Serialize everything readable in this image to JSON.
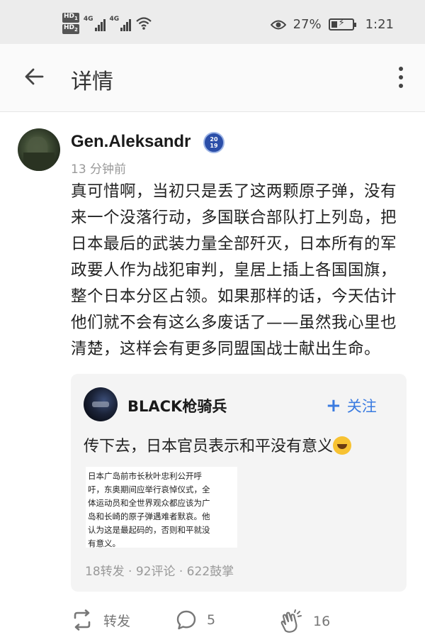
{
  "status_bar": {
    "network_1": "4G",
    "network_2": "4G",
    "battery_percent": "27%",
    "time": "1:21"
  },
  "header": {
    "title": "详情"
  },
  "post": {
    "username": "Gen.Aleksandr",
    "badge_line1": "20",
    "badge_line2": "19",
    "time_ago": "13 分钟前",
    "content_lines": [
      "真可惜啊，当初只是丢了这两颗原子弹，没有",
      "来一个没落行动，多国联合部队打上列岛，把",
      "日本最后的武装力量全部歼灭，日本所有的军",
      "政要人作为战犯审判，皇居上插上各国国旗，",
      "整个日本分区占领。如果那样的话，今天估计",
      "他们就不会有这么多废话了——虽然我心里也",
      "清楚，这样会有更多同盟国战士献出生命。"
    ]
  },
  "quote": {
    "username": "BLACK枪骑兵",
    "follow_label": "关注",
    "text": "传下去，日本官员表示和平没有意义",
    "image_text_lines": [
      "日本广岛前市长秋叶忠利公开呼",
      "吁，东奥期间应举行哀悼仪式，全",
      "体运动员和全世界观众都应该为广",
      "岛和长崎的原子弹遇难者默哀。他",
      "认为这是最起码的，否则和平就没",
      "有意义。"
    ],
    "stats": "18转发 · 92评论 · 622鼓掌"
  },
  "actions": {
    "repost_label": "转发",
    "comment_count": "5",
    "clap_count": "16"
  },
  "colors": {
    "accent": "#3a7be0",
    "muted": "#999999",
    "status_bar_bg": "#ececec"
  },
  "icons": {
    "back": "arrow-left-icon",
    "more": "more-vertical-icon",
    "repost": "repost-icon",
    "comment": "comment-bubble-icon",
    "clap": "clap-icon"
  }
}
